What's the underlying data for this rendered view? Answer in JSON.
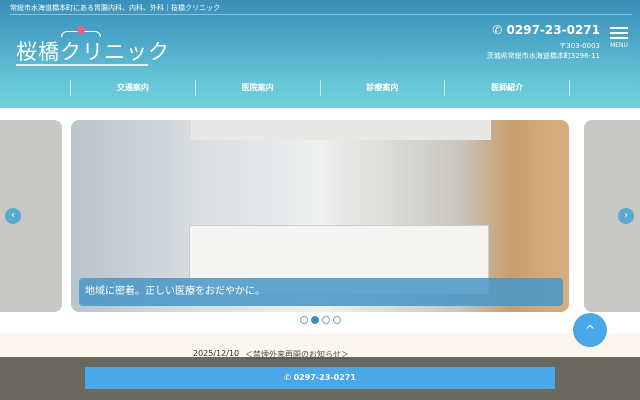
{
  "header": {
    "tagline": "常総市水海道橋本町にある胃腸内科、内科、外科｜桜橋クリニック",
    "logo_text": "桜橋クリニック",
    "phone": "0297-23-0271",
    "zip": "〒303-0003",
    "address": "茨城県常総市水海道橋本町3296-11",
    "menu_label": "MENU"
  },
  "nav": [
    {
      "label": "交通案内"
    },
    {
      "label": "医院案内"
    },
    {
      "label": "診療案内"
    },
    {
      "label": "医師紹介"
    }
  ],
  "slider": {
    "caption": "地域に密着。正しい医療をおだやかに。",
    "prev": "‹",
    "next": "›",
    "current": 2,
    "total": 4
  },
  "news": {
    "date": "2025/12/10",
    "title": "＜禁煙外来再開のお知らせ＞"
  },
  "call_bar": {
    "phone": "0297-23-0271"
  },
  "back_to_top": "^"
}
